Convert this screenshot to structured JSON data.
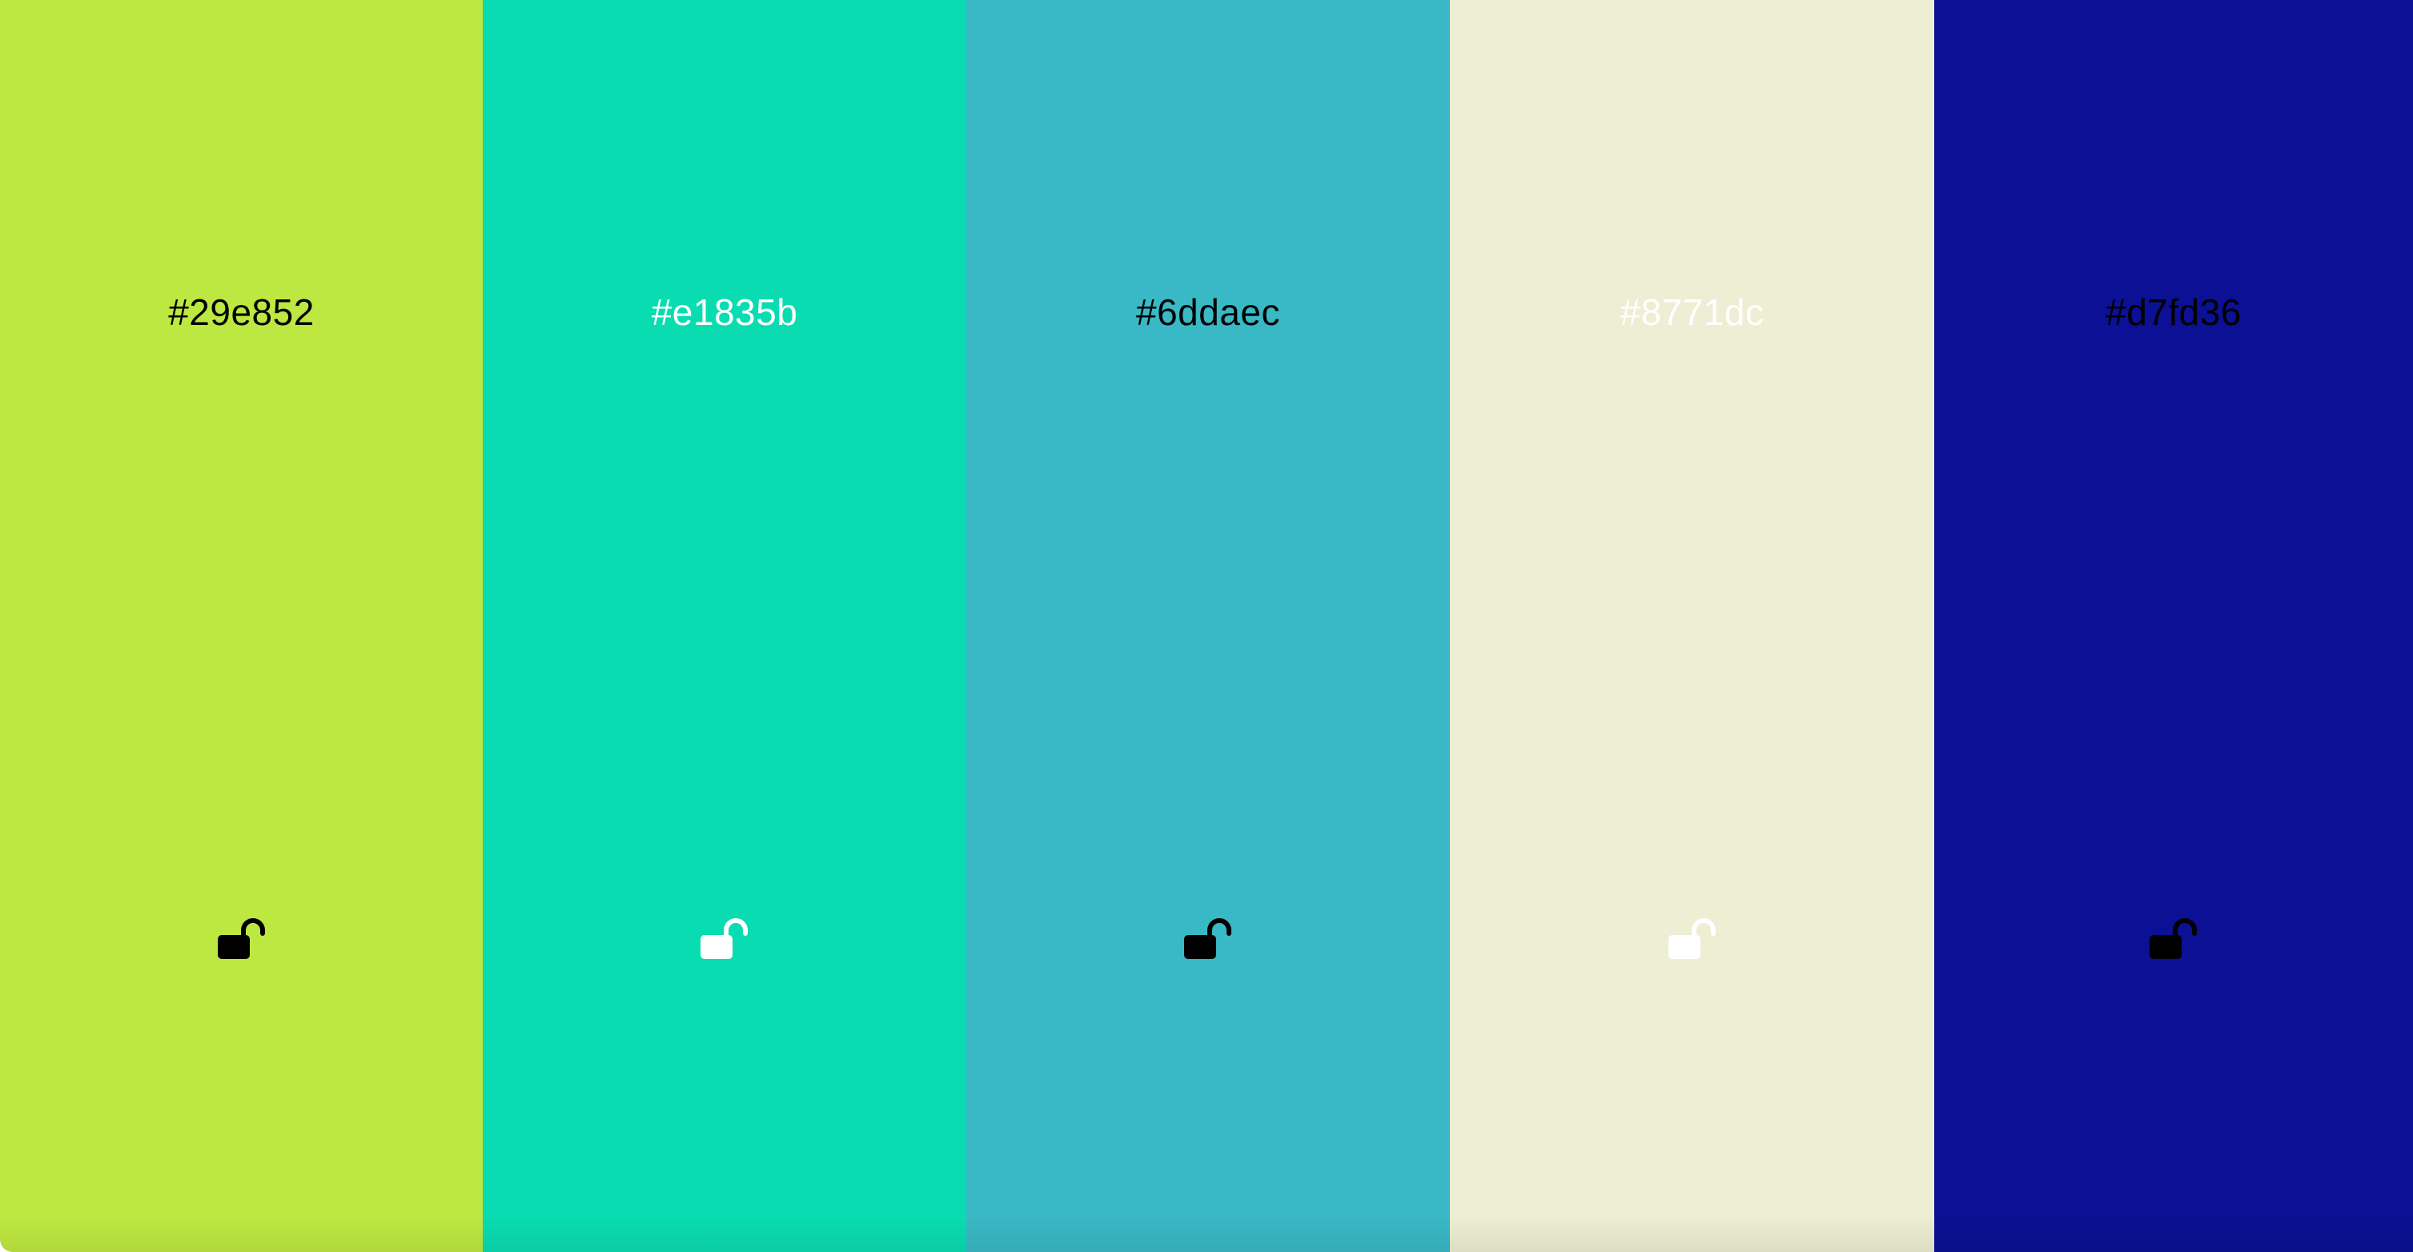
{
  "swatches": [
    {
      "hex": "#29e852",
      "background": "#bde841",
      "text_color": "#000000",
      "lock_icon": "unlocked-padlock-icon",
      "locked": false
    },
    {
      "hex": "#e1835b",
      "background": "#0adcb1",
      "text_color": "#ffffff",
      "lock_icon": "unlocked-padlock-icon",
      "locked": false
    },
    {
      "hex": "#6ddaec",
      "background": "#39b9c5",
      "text_color": "#000000",
      "lock_icon": "unlocked-padlock-icon",
      "locked": false
    },
    {
      "hex": "#8771dc",
      "background": "#edeed3",
      "text_color": "#ffffff",
      "lock_icon": "unlocked-padlock-icon",
      "locked": false
    },
    {
      "hex": "#d7fd36",
      "background": "#0b1094",
      "text_color": "#000000",
      "lock_icon": "unlocked-padlock-icon",
      "locked": false
    }
  ]
}
